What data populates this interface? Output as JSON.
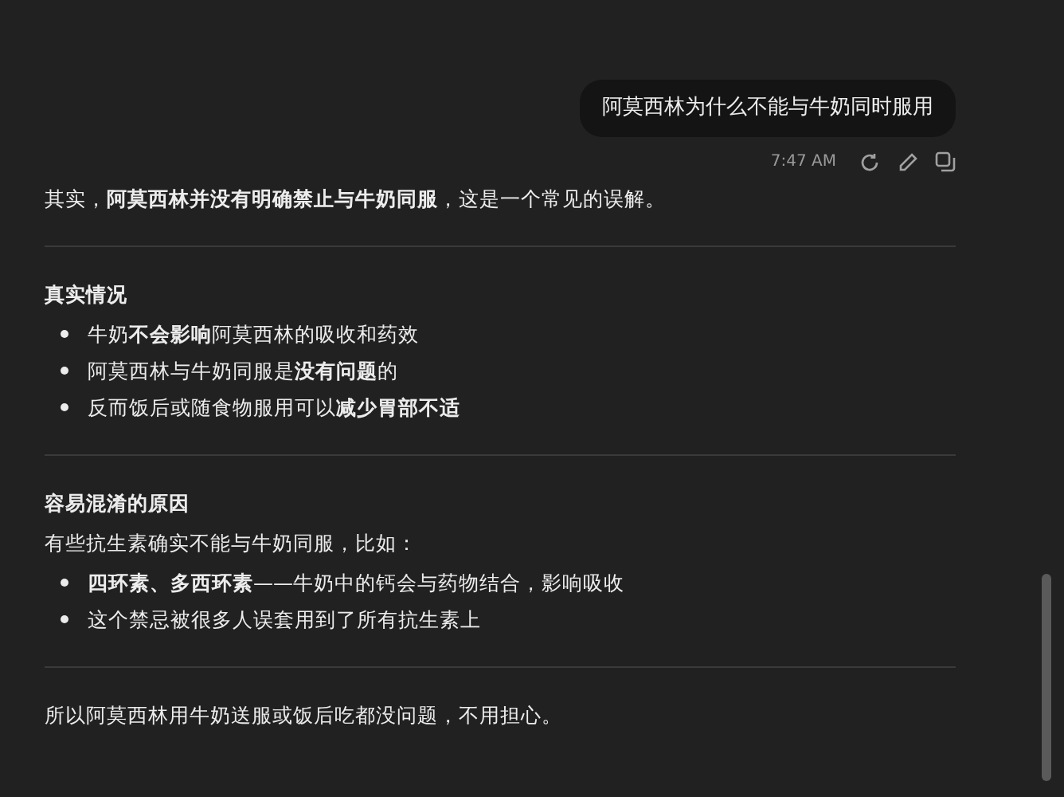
{
  "user_message": {
    "text": "阿莫西林为什么不能与牛奶同时服用",
    "time": "7:47 AM"
  },
  "response": [
    {
      "kind": "paragraph",
      "text": "其实，**阿莫西林并没有明确禁止与牛奶同服**，这是一个常见的误解。"
    },
    {
      "kind": "divider"
    },
    {
      "kind": "heading",
      "text": "真实情况"
    },
    {
      "kind": "list",
      "items": [
        "牛奶**不会影响**阿莫西林的吸收和药效",
        "阿莫西林与牛奶同服是**没有问题**的",
        "反而饭后或随食物服用可以**减少胃部不适**"
      ]
    },
    {
      "kind": "divider"
    },
    {
      "kind": "heading",
      "text": "容易混淆的原因"
    },
    {
      "kind": "paragraph",
      "text": "有些抗生素确实不能与牛奶同服，比如："
    },
    {
      "kind": "list",
      "items": [
        "**四环素、多西环素**——牛奶中的钙会与药物结合，影响吸收",
        "这个禁忌被很多人误套用到了所有抗生素上"
      ]
    },
    {
      "kind": "divider"
    },
    {
      "kind": "paragraph",
      "text": "所以阿莫西林用牛奶送服或饭后吃都没问题，不用担心。"
    }
  ]
}
